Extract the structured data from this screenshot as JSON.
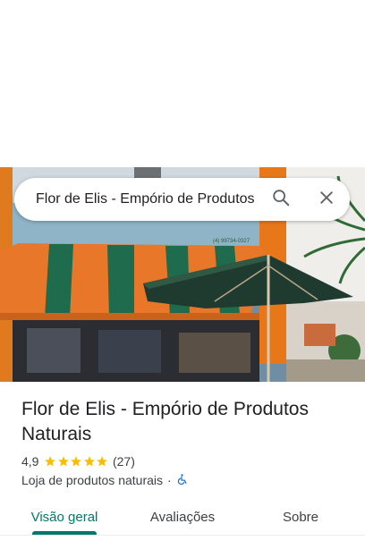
{
  "search": {
    "query": "Flor de Elis - Empório de Produtos Naturais",
    "search_icon": "search-icon",
    "close_icon": "close-icon"
  },
  "place": {
    "name": "Flor de Elis - Empório de Produtos Naturais",
    "rating": "4,9",
    "rating_value": 4.9,
    "review_count": "(27)",
    "category": "Loja de produtos naturais",
    "separator": "·",
    "accessibility_icon": "wheelchair-icon",
    "photo_sign_text": "(4) 99734-0327"
  },
  "tabs": [
    {
      "label": "Visão geral",
      "active": true
    },
    {
      "label": "Avaliações",
      "active": false
    },
    {
      "label": "Sobre",
      "active": false
    }
  ],
  "colors": {
    "accent": "#00796b",
    "star": "#fbbc04",
    "accessibility": "#1a73e8"
  }
}
